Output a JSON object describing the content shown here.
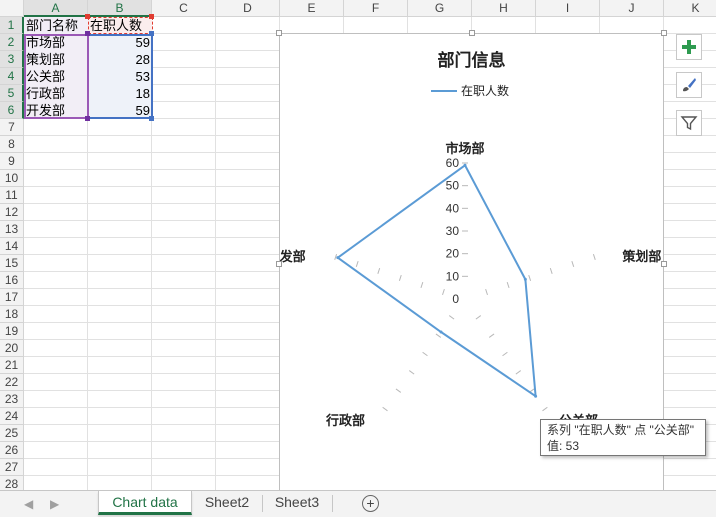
{
  "columns": [
    "A",
    "B",
    "C",
    "D",
    "E",
    "F",
    "G",
    "H",
    "I",
    "J",
    "K"
  ],
  "rows": [
    "1",
    "2",
    "3",
    "4",
    "5",
    "6",
    "7",
    "8",
    "9",
    "10",
    "11",
    "12",
    "13",
    "14",
    "15",
    "16",
    "17",
    "18",
    "19",
    "20",
    "21",
    "22",
    "23",
    "24",
    "25",
    "26",
    "27",
    "28"
  ],
  "cells": {
    "A1": "部门名称",
    "B1": "在职人数",
    "A2": "市场部",
    "B2": "59",
    "A3": "策划部",
    "B3": "28",
    "A4": "公关部",
    "B4": "53",
    "A5": "行政部",
    "B5": "18",
    "A6": "开发部",
    "B6": "59"
  },
  "chart": {
    "title": "部门信息",
    "legend": "在职人数",
    "tooltip_line1": "系列 \"在职人数\" 点 \"公关部\"",
    "tooltip_line2": "值: 53"
  },
  "chart_data": {
    "type": "radar",
    "title": "部门信息",
    "categories": [
      "市场部",
      "策划部",
      "公关部",
      "行政部",
      "开发部"
    ],
    "series": [
      {
        "name": "在职人数",
        "values": [
          59,
          28,
          53,
          18,
          59
        ],
        "color": "#5b9bd5"
      }
    ],
    "ylim": [
      0,
      60
    ],
    "ticks": [
      "0",
      "10",
      "20",
      "30",
      "40",
      "50",
      "60"
    ],
    "legend": "top"
  },
  "side_buttons": {
    "elements": "plus-icon",
    "styles": "brush-icon",
    "filters": "funnel-icon"
  },
  "tabs": [
    "Chart data",
    "Sheet2",
    "Sheet3"
  ],
  "active_tab": "Chart data",
  "colors": {
    "accent": "#217346",
    "series": "#5b9bd5",
    "series_range": "#4472c4",
    "category_range": "#7030a0",
    "name_range": "#e03c31"
  }
}
